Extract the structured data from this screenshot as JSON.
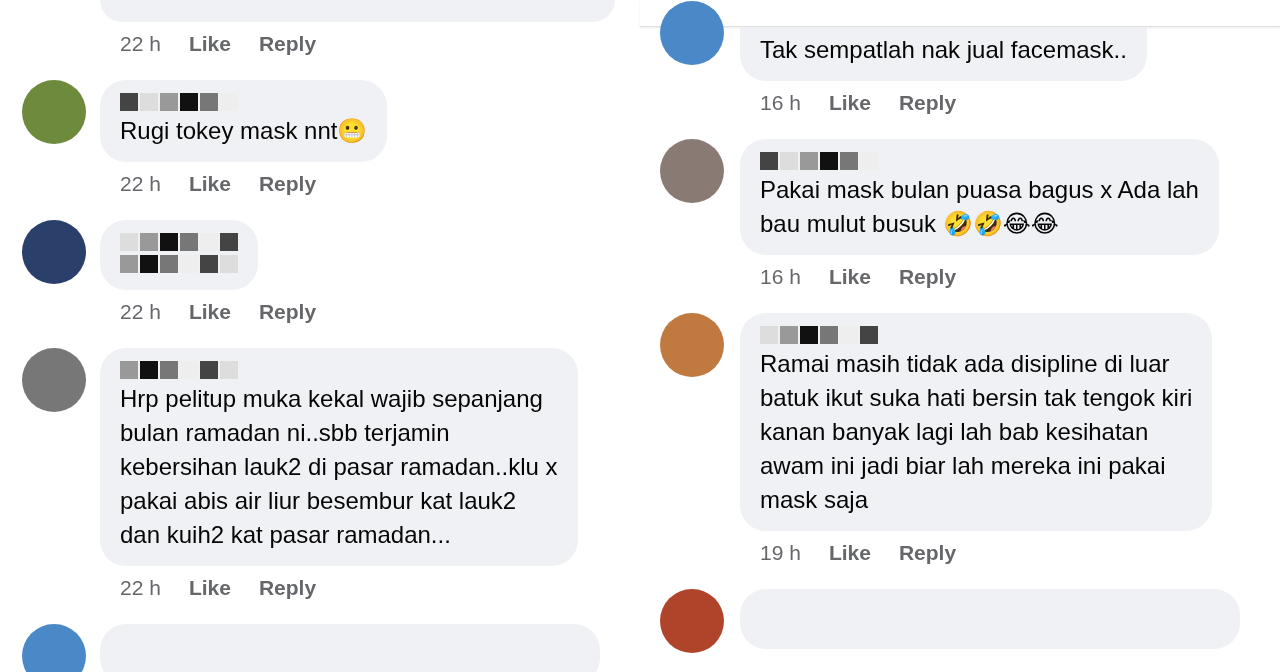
{
  "left_column": {
    "comments": [
      {
        "kind": "cut_top",
        "time": "22 h",
        "actions": [
          "Like",
          "Reply"
        ]
      },
      {
        "kind": "comment",
        "time": "22 h",
        "actions": [
          "Like",
          "Reply"
        ],
        "lines": [
          "Rugi tokey mask nnt😬"
        ]
      },
      {
        "kind": "comment",
        "time": "22 h",
        "actions": [
          "Like",
          "Reply"
        ]
      },
      {
        "kind": "comment",
        "time": "22 h",
        "actions": [
          "Like",
          "Reply"
        ],
        "lines": [
          "Hrp pelitup muka kekal wajib sepanjang",
          "bulan ramadan ni..sbb terjamin",
          "kebersihan lauk2 di pasar ramadan..klu x",
          "pakai abis air liur besembur kat lauk2",
          "dan kuih2 kat pasar ramadan..."
        ]
      },
      {
        "kind": "cut_bottom"
      }
    ]
  },
  "right_column": {
    "comments": [
      {
        "kind": "cut_name",
        "time": "16 h",
        "actions": [
          "Like",
          "Reply"
        ],
        "lines": [
          "Tak sempatlah nak jual facemask.."
        ]
      },
      {
        "kind": "comment",
        "time": "16 h",
        "actions": [
          "Like",
          "Reply"
        ],
        "lines": [
          "Pakai mask bulan puasa bagus x Ada lah",
          "bau mulut busuk 🤣🤣😂😂"
        ]
      },
      {
        "kind": "comment",
        "time": "19 h",
        "actions": [
          "Like",
          "Reply"
        ],
        "lines": [
          "Ramai masih tidak ada disipline di luar",
          "batuk ikut suka hati bersin tak tengok kiri",
          "kanan banyak lagi lah bab kesihatan",
          "awam ini jadi biar lah mereka ini pakai",
          "mask saja"
        ]
      },
      {
        "kind": "cut_bottom"
      }
    ]
  }
}
